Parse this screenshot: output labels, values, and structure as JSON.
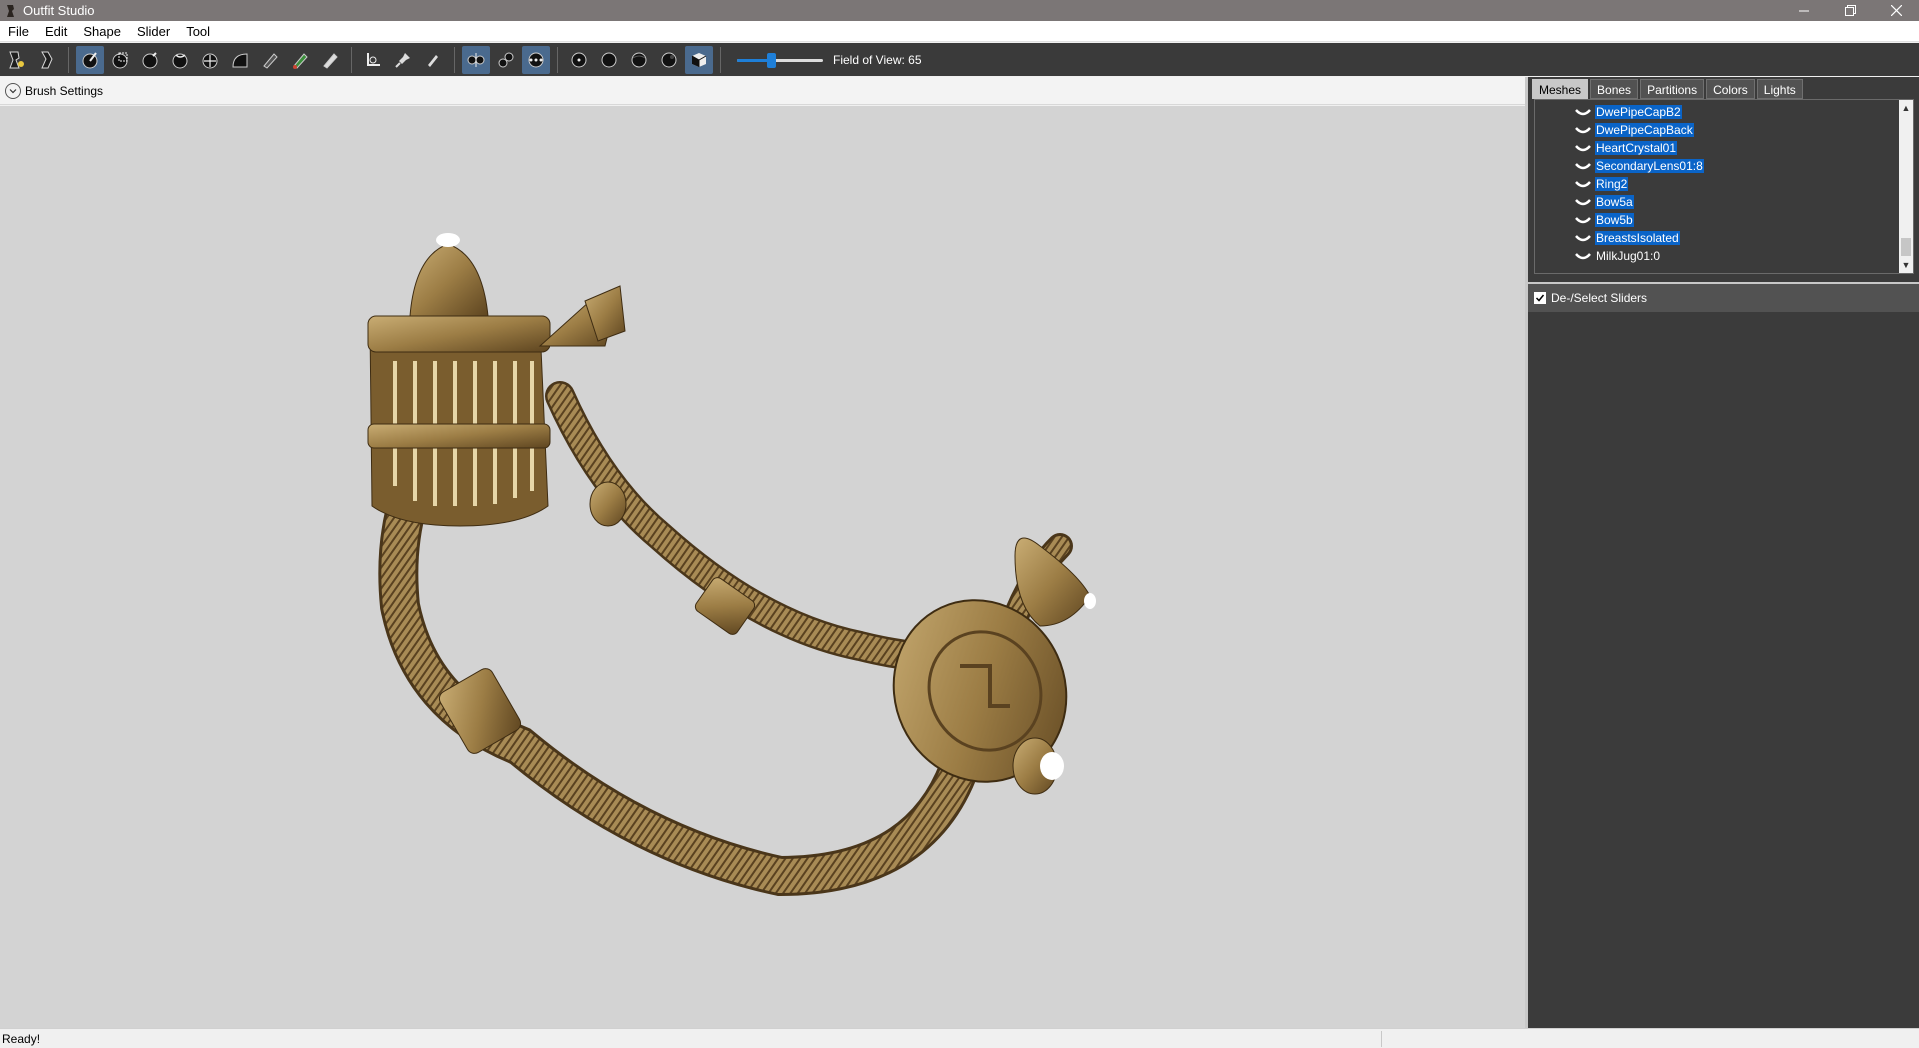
{
  "window": {
    "title": "Outfit Studio"
  },
  "menu": {
    "items": [
      "File",
      "Edit",
      "Shape",
      "Slider",
      "Tool"
    ]
  },
  "toolbar": {
    "fov_label": "Field of View: 65",
    "fov_value": 65,
    "fov_fraction": 0.4
  },
  "brush_settings": {
    "label": "Brush Settings"
  },
  "right_panel": {
    "tabs": [
      "Meshes",
      "Bones",
      "Partitions",
      "Colors",
      "Lights"
    ],
    "active_tab": "Meshes",
    "meshes": [
      {
        "name": "DwePipeCapB2",
        "selected": true
      },
      {
        "name": "DwePipeCapBack",
        "selected": true
      },
      {
        "name": "HeartCrystal01",
        "selected": true
      },
      {
        "name": "SecondaryLens01:8",
        "selected": true
      },
      {
        "name": "Ring2",
        "selected": true
      },
      {
        "name": "Bow5a",
        "selected": true
      },
      {
        "name": "Bow5b",
        "selected": true
      },
      {
        "name": "BreastsIsolated",
        "selected": true
      },
      {
        "name": "MilkJug01:0",
        "selected": false
      }
    ],
    "sliders_header": {
      "label": "De-/Select Sliders",
      "checked": true
    }
  },
  "status": {
    "text": "Ready!"
  },
  "colors": {
    "accent": "#1e7fd8",
    "selection": "#0a64c8",
    "panel": "#3b3b3b",
    "viewport": "#d3d3d3"
  }
}
